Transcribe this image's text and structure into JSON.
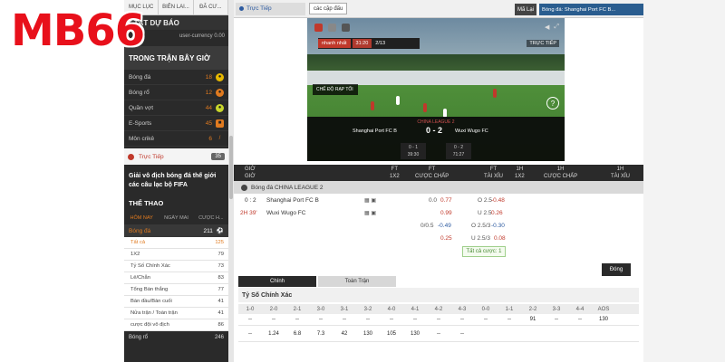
{
  "logo": "MB66",
  "sidebar": {
    "top_tabs": [
      "MỤC LỤC",
      "BIÊN LAI...",
      "ĐÃ CƯ..."
    ],
    "prediction_title": "$ TẤT DỰ BÁO",
    "currency_placeholder": "user-currency 0.00",
    "in_play_title": "TRONG TRẬN BÂY GIỜ",
    "sports": [
      {
        "name": "Bóng đá",
        "count": "18"
      },
      {
        "name": "Bóng rổ",
        "count": "12"
      },
      {
        "name": "Quần vợt",
        "count": "44"
      },
      {
        "name": "E-Sports",
        "count": "45"
      },
      {
        "name": "Môn crikê",
        "count": "6"
      }
    ],
    "live": {
      "name": "Trực Tiếp",
      "count": "35"
    },
    "promo": "Giải vô địch bóng đá thế giới các câu lạc bộ FIFA",
    "sports_title": "THỂ THAO",
    "day_tabs": [
      "HÔM NAY",
      "NGÀY MAI",
      "CƯỢC H..."
    ],
    "football": {
      "name": "Bóng đá",
      "count": "211"
    },
    "bet_types": [
      {
        "name": "Tất cả",
        "count": "125",
        "active": true
      },
      {
        "name": "1X2",
        "count": "79"
      },
      {
        "name": "Tỷ Số Chính Xác",
        "count": "73"
      },
      {
        "name": "Lẻ/Chẵn",
        "count": "83"
      },
      {
        "name": "Tổng Bàn thắng",
        "count": "77"
      },
      {
        "name": "Bàn đầu/Bàn cuối",
        "count": "41"
      },
      {
        "name": "Nửa trận / Toàn trận",
        "count": "41"
      },
      {
        "name": "cược đội vô địch",
        "count": "86"
      }
    ],
    "last_row": {
      "name": "Bóng rổ",
      "count": "246"
    }
  },
  "main": {
    "live_tab": "Trực Tiếp",
    "pairs_button": "các cặp đấu",
    "refresh_button": "Mã Lại",
    "match_title": "Bóng đá: Shanghai Port FC B...",
    "video": {
      "bug_left": "nhanh nhất",
      "bug_mid": "31:20",
      "bug_right": "2/13",
      "live_badge": "TRỰC TIẾP",
      "theater": "CHẾ ĐỘ RẠP TỐI",
      "league": "CHINA LEAGUE 2",
      "home": "Shanghai Port FC B",
      "away": "Wuxi Wugo FC",
      "score_home": "0",
      "score_away": "2",
      "period1": {
        "score": "0 - 1",
        "time": "39:30"
      },
      "period2": {
        "score": "0 - 2",
        "time": "71:27"
      }
    },
    "table_header": {
      "time": [
        "GIỜ",
        "GIỜ"
      ],
      "ft_1x2": [
        "FT",
        "1X2"
      ],
      "ft_hdp": [
        "FT",
        "CƯỢC CHẤP"
      ],
      "ft_ou": [
        "FT",
        "TÀI XỈU"
      ],
      "h1_1x2": [
        "1H",
        "1X2"
      ],
      "h1_hdp": [
        "1H",
        "CƯỢC CHẤP"
      ],
      "h1_ou": [
        "1H",
        "TÀI XỈU"
      ]
    },
    "league_row": "Bóng đá  CHINA LEAGUE 2",
    "match": {
      "score": "0 : 2",
      "period": "2H 39'",
      "home": "Shanghai Port FC B",
      "away": "Wuxi Wugo FC",
      "rows": [
        {
          "hdp_line": "0.0",
          "hdp_odds": "0.77",
          "ou_line": "O 2.5",
          "ou_odds": "-0.48"
        },
        {
          "hdp_line": "",
          "hdp_odds": "0.99",
          "ou_line": "U 2.5",
          "ou_odds": "0.26"
        },
        {
          "hdp_line": "0/0.5",
          "hdp_odds": "-0.49",
          "ou_line": "O 2.5/3",
          "ou_odds": "-0.30"
        },
        {
          "hdp_line": "",
          "hdp_odds": "0.25",
          "ou_line": "U 2.5/3",
          "ou_odds": "0.08"
        }
      ]
    },
    "all_bets": "Tất cả cược: 1",
    "close_button": "Đóng",
    "bottom_tabs": [
      "Chính",
      "Toàn Trận"
    ],
    "correct_score_title": "Tỷ Số Chính Xác",
    "cs_headers": [
      "1-0",
      "2-0",
      "2-1",
      "3-0",
      "3-1",
      "3-2",
      "4-0",
      "4-1",
      "4-2",
      "4-3",
      "0-0",
      "1-1",
      "2-2",
      "3-3",
      "4-4",
      "AOS"
    ],
    "cs_row1": [
      "--",
      "--",
      "--",
      "--",
      "--",
      "--",
      "--",
      "--",
      "--",
      "--",
      "--",
      "--",
      "91",
      "--",
      "--",
      "130"
    ],
    "cs_row2": [
      "--",
      "1.24",
      "6.8",
      "7.3",
      "42",
      "130",
      "105",
      "130",
      "--",
      "--",
      "",
      "",
      "",
      "",
      "",
      ""
    ]
  }
}
